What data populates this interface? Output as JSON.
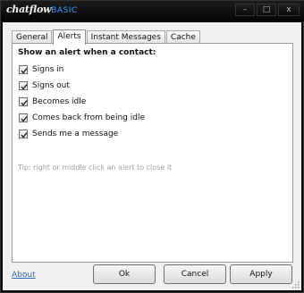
{
  "window": {
    "title_brand": "chatflow",
    "title_edition": "BASIC",
    "minimize_glyph": "–",
    "maximize_glyph": "□",
    "close_glyph": "x"
  },
  "tabs": [
    {
      "label": "General",
      "active": false
    },
    {
      "label": "Alerts",
      "active": true
    },
    {
      "label": "Instant Messages",
      "active": false
    },
    {
      "label": "Cache",
      "active": false
    }
  ],
  "alerts": {
    "heading": "Show an alert when a contact:",
    "options": [
      {
        "label": "Signs in",
        "checked": true
      },
      {
        "label": "Signs out",
        "checked": true
      },
      {
        "label": "Becomes idle",
        "checked": true
      },
      {
        "label": "Comes back from being idle",
        "checked": true
      },
      {
        "label": "Sends me a message",
        "checked": true
      }
    ],
    "tip": "Tip: right or middle click an alert to close it"
  },
  "footer": {
    "about_label": "About",
    "ok_label": "Ok",
    "cancel_label": "Cancel",
    "apply_label": "Apply"
  },
  "colors": {
    "edition_accent": "#3aa0ff",
    "link": "#2a6ebf",
    "tip_text": "#a0a0a0"
  }
}
